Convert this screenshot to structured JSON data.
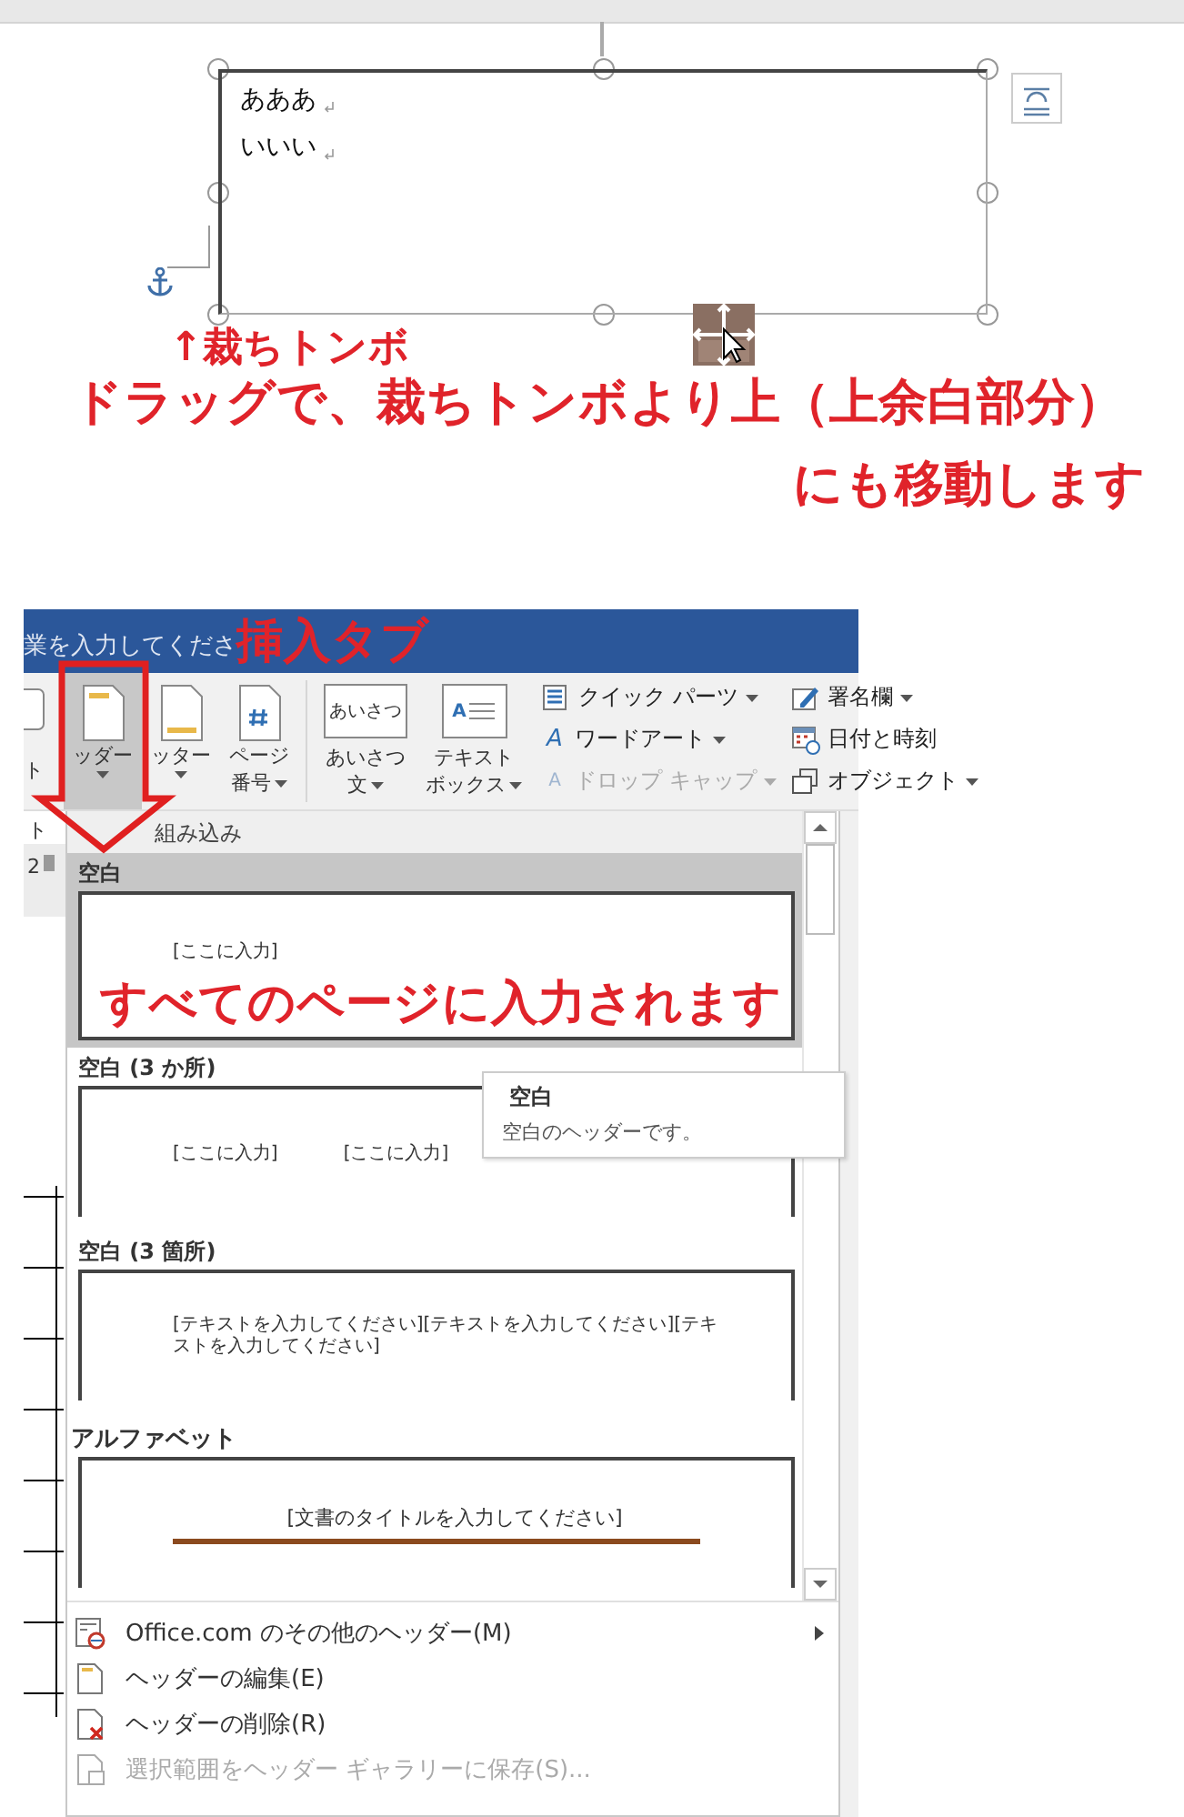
{
  "canvas": {
    "paragraphs": [
      {
        "text": "あああ"
      },
      {
        "text": "いいい"
      }
    ]
  },
  "annotations": [
    {
      "kind": "crop",
      "text": "↑裁ちトンボ"
    },
    {
      "kind": "drag",
      "text": "ドラッグで、裁ちトンボより上（上余白部分）"
    },
    {
      "kind": "move",
      "text": "にも移動します"
    },
    {
      "kind": "tab",
      "text": "挿入タブ"
    },
    {
      "kind": "pages",
      "text": "すべてのページに入力されます"
    }
  ],
  "window": {
    "title": "業を入力してくださ"
  },
  "ribbon": {
    "left_label": "ト",
    "large_buttons": [
      {
        "kind": "header",
        "lines": [
          "ッダー"
        ],
        "selected": true
      },
      {
        "kind": "footer",
        "lines": [
          "ッター"
        ],
        "selected": false
      },
      {
        "kind": "page-number",
        "lines": [
          "ページ",
          "番号"
        ],
        "selected": false
      },
      {
        "kind": "greeting",
        "icon_text": "あいさつ",
        "lines": [
          "あいさつ",
          "文"
        ],
        "selected": false
      },
      {
        "kind": "textbox",
        "icon_text": "A",
        "lines": [
          "テキスト",
          "ボックス"
        ],
        "selected": false
      }
    ],
    "small_buttons": [
      {
        "kind": "quick-parts",
        "label": "クイック パーツ",
        "caret": true,
        "disabled": false
      },
      {
        "kind": "wordart",
        "icon_text": "A",
        "label": "ワードアート",
        "caret": true,
        "disabled": false
      },
      {
        "kind": "drop-cap",
        "icon_text": "A",
        "label": "ドロップ キャップ",
        "caret": true,
        "disabled": true
      },
      {
        "kind": "signature",
        "label": "署名欄",
        "caret": true,
        "disabled": false
      },
      {
        "kind": "datetime",
        "label": "日付と時刻",
        "caret": false,
        "disabled": false
      },
      {
        "kind": "object",
        "label": "オブジェクト",
        "caret": true,
        "disabled": false
      }
    ]
  },
  "left_strip": {
    "group_label": "ト",
    "number": "2"
  },
  "gallery": {
    "heading": "組み込み",
    "sections": [
      {
        "kind": "blank",
        "title": "空白",
        "selected": true,
        "placeholders": [
          "[ここに入力]"
        ]
      },
      {
        "kind": "blank-three",
        "title": "空白 (3 か所)",
        "selected": false,
        "placeholders": [
          "[ここに入力]",
          "[ここに入力]"
        ]
      },
      {
        "kind": "blank-columns",
        "title": "空白 (3 箇所)",
        "selected": false,
        "placeholders": [
          "[テキストを入力してください][テキストを入力してください][テキストを入力してください]"
        ]
      },
      {
        "kind": "alphabet",
        "title": "アルファベット",
        "selected": false,
        "placeholders": [
          "[文書のタイトルを入力してください]"
        ]
      }
    ],
    "tooltip": {
      "title": "空白",
      "text": "空白のヘッダーです。"
    }
  },
  "menu": [
    {
      "kind": "web",
      "text": "Office.com のその他のヘッダー(M)",
      "submenu": true,
      "disabled": false
    },
    {
      "kind": "edit",
      "text": "ヘッダーの編集(E)",
      "submenu": false,
      "disabled": false
    },
    {
      "kind": "delete",
      "text": "ヘッダーの削除(R)",
      "submenu": false,
      "disabled": false
    },
    {
      "kind": "save",
      "text": "選択範囲をヘッダー ギャラリーに保存(S)...",
      "submenu": false,
      "disabled": true
    }
  ]
}
